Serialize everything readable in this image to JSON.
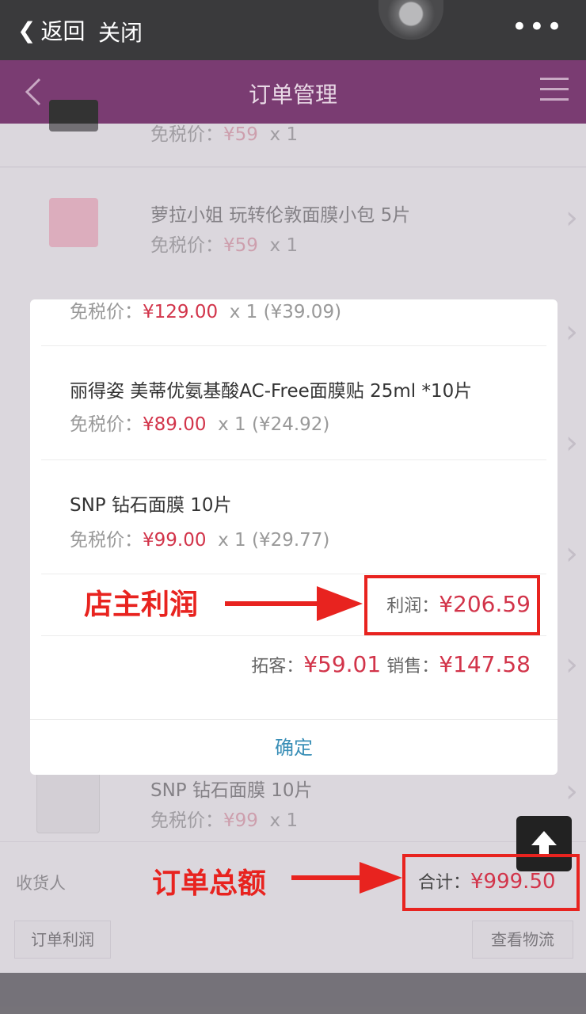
{
  "wechat_bar": {
    "back_label": "返回",
    "close_label": "关闭",
    "more_label": "•••"
  },
  "header": {
    "title": "订单管理"
  },
  "list": [
    {
      "name": "",
      "price_label": "免税价：",
      "price": "¥59",
      "qty": "x 1"
    },
    {
      "name": "萝拉小姐 玩转伦敦面膜小包 5片",
      "price_label": "免税价：",
      "price": "¥59",
      "qty": "x 1"
    },
    {
      "name": "SNP 钻石面膜 10片",
      "price_label": "免税价：",
      "price": "¥99",
      "qty": "x 1"
    }
  ],
  "modal": {
    "items": [
      {
        "name": "",
        "price_label": "免税价：",
        "price": "¥129.00",
        "qty": "x 1",
        "profit": "(¥39.09)"
      },
      {
        "name": "丽得姿 美蒂优氨基酸AC-Free面膜贴 25ml *10片",
        "price_label": "免税价：",
        "price": "¥89.00",
        "qty": "x 1",
        "profit": "(¥24.92)"
      },
      {
        "name": "SNP 钻石面膜 10片",
        "price_label": "免税价：",
        "price": "¥99.00",
        "qty": "x 1",
        "profit": "(¥29.77)"
      }
    ],
    "profit_label": "利润：",
    "profit_value": "¥206.59",
    "tuoke_label": "拓客：",
    "tuoke_value": "¥59.01",
    "sales_label": "销售：",
    "sales_value": "¥147.58",
    "confirm_label": "确定"
  },
  "annotations": {
    "shop_profit": "店主利润",
    "order_total": "订单总额"
  },
  "footer": {
    "receiver_label": "收货人",
    "total_label": "合计：",
    "total_value": "¥999.50",
    "order_profit_button": "订单利润",
    "logistics_button": "查看物流"
  },
  "colors": {
    "header_purple": "#7a3c72",
    "price_red": "#d2344a",
    "annotation_red": "#e8231f",
    "confirm_blue": "#3a8fb7"
  }
}
